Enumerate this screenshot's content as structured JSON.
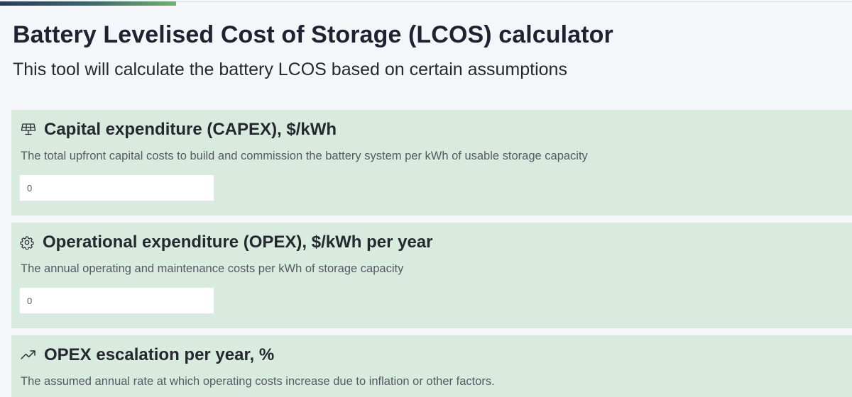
{
  "header": {
    "title": "Battery Levelised Cost of Storage (LCOS) calculator",
    "subtitle": "This tool will calculate the battery LCOS based on certain assumptions"
  },
  "fields": [
    {
      "icon": "solar-panel-icon",
      "title": "Capital expenditure (CAPEX), $/kWh",
      "description": "The total upfront capital costs to build and commission the battery system per kWh of usable storage capacity",
      "value": "0"
    },
    {
      "icon": "gear-icon",
      "title": "Operational expenditure (OPEX), $/kWh per year",
      "description": "The annual operating and maintenance costs per kWh of storage capacity",
      "value": "0"
    },
    {
      "icon": "trending-up-icon",
      "title": "OPEX escalation per year, %",
      "description": "The assumed annual rate at which operating costs increase due to inflation or other factors."
    }
  ],
  "colors": {
    "page_bg": "#f5f6fa",
    "card_bg": "#d9eadf",
    "accent_start": "#283a5f",
    "accent_end": "#6cb36f",
    "title_text": "#1f2230",
    "muted_text": "#555a63"
  }
}
